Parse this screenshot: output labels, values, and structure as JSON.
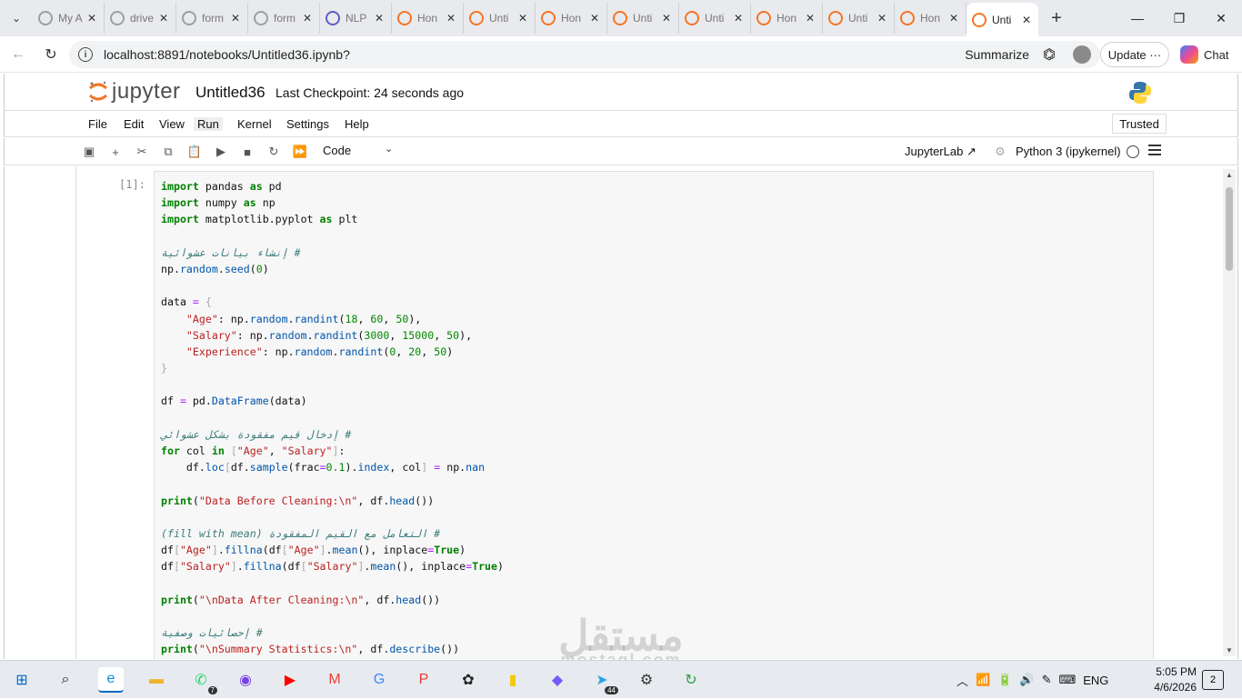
{
  "browser": {
    "tabs": [
      {
        "label": "My A",
        "icon": "globe-icon",
        "color": "#9aa0a6"
      },
      {
        "label": "drive",
        "icon": "drive-icon",
        "color": "#9aa0a6"
      },
      {
        "label": "form",
        "icon": "drive-icon",
        "color": "#9aa0a6"
      },
      {
        "label": "form",
        "icon": "drive-icon",
        "color": "#9aa0a6"
      },
      {
        "label": "NLP",
        "icon": "slides-icon",
        "color": "#5b5fc7"
      },
      {
        "label": "Hon",
        "icon": "jupyter-icon",
        "color": "#f37626"
      },
      {
        "label": "Unti",
        "icon": "notebook-icon",
        "color": "#f37626"
      },
      {
        "label": "Hon",
        "icon": "jupyter-icon",
        "color": "#f37626"
      },
      {
        "label": "Unti",
        "icon": "notebook-icon",
        "color": "#f37626"
      },
      {
        "label": "Unti",
        "icon": "jupyter-icon",
        "color": "#f37626"
      },
      {
        "label": "Hon",
        "icon": "jupyter-icon",
        "color": "#f37626"
      },
      {
        "label": "Unti",
        "icon": "notebook-icon",
        "color": "#f37626"
      },
      {
        "label": "Hon",
        "icon": "jupyter-icon",
        "color": "#f37626"
      },
      {
        "label": "Unti",
        "icon": "notebook-icon",
        "color": "#f37626",
        "active": true
      }
    ],
    "url": "localhost:8891/notebooks/Untitled36.ipynb?",
    "summarize_label": "Summarize",
    "update_label": "Update",
    "chat_label": "Chat"
  },
  "jupyter": {
    "logo_text": "jupyter",
    "notebook_title": "Untitled36",
    "checkpoint": "Last Checkpoint: 24 seconds ago",
    "menus": [
      "File",
      "Edit",
      "View",
      "Run",
      "Kernel",
      "Settings",
      "Help"
    ],
    "trusted_label": "Trusted",
    "cell_type": "Code",
    "jupyterlab_label": "JupyterLab",
    "kernel_label": "Python 3 (ipykernel)",
    "cell_prompt": "[1]:"
  },
  "code_lines": [
    [
      [
        "kw",
        "import"
      ],
      [
        "",
        " pandas "
      ],
      [
        "kw",
        "as"
      ],
      [
        "",
        " pd"
      ]
    ],
    [
      [
        "kw",
        "import"
      ],
      [
        "",
        " numpy "
      ],
      [
        "kw",
        "as"
      ],
      [
        "",
        " np"
      ]
    ],
    [
      [
        "kw",
        "import"
      ],
      [
        "",
        " matplotlib.pyplot "
      ],
      [
        "kw",
        "as"
      ],
      [
        "",
        " plt"
      ]
    ],
    [],
    [
      [
        "cm",
        "# إنشاء بيانات عشوائية"
      ]
    ],
    [
      [
        "",
        "np."
      ],
      [
        "fn",
        "random"
      ],
      [
        "",
        "."
      ],
      [
        "fn",
        "seed"
      ],
      [
        "",
        "("
      ],
      [
        "num",
        "0"
      ],
      [
        "",
        ")"
      ]
    ],
    [],
    [
      [
        "",
        "data "
      ],
      [
        "op",
        "="
      ],
      [
        "",
        " "
      ],
      [
        "br",
        "{"
      ]
    ],
    [
      [
        "",
        "    "
      ],
      [
        "str",
        "\"Age\""
      ],
      [
        "",
        ": np."
      ],
      [
        "fn",
        "random"
      ],
      [
        "",
        "."
      ],
      [
        "fn",
        "randint"
      ],
      [
        "",
        "("
      ],
      [
        "num",
        "18"
      ],
      [
        "",
        ", "
      ],
      [
        "num",
        "60"
      ],
      [
        "",
        ", "
      ],
      [
        "num",
        "50"
      ],
      [
        "",
        "),"
      ]
    ],
    [
      [
        "",
        "    "
      ],
      [
        "str",
        "\"Salary\""
      ],
      [
        "",
        ": np."
      ],
      [
        "fn",
        "random"
      ],
      [
        "",
        "."
      ],
      [
        "fn",
        "randint"
      ],
      [
        "",
        "("
      ],
      [
        "num",
        "3000"
      ],
      [
        "",
        ", "
      ],
      [
        "num",
        "15000"
      ],
      [
        "",
        ", "
      ],
      [
        "num",
        "50"
      ],
      [
        "",
        "),"
      ]
    ],
    [
      [
        "",
        "    "
      ],
      [
        "str",
        "\"Experience\""
      ],
      [
        "",
        ": np."
      ],
      [
        "fn",
        "random"
      ],
      [
        "",
        "."
      ],
      [
        "fn",
        "randint"
      ],
      [
        "",
        "("
      ],
      [
        "num",
        "0"
      ],
      [
        "",
        ", "
      ],
      [
        "num",
        "20"
      ],
      [
        "",
        ", "
      ],
      [
        "num",
        "50"
      ],
      [
        "",
        ")"
      ]
    ],
    [
      [
        "br",
        "}"
      ]
    ],
    [],
    [
      [
        "",
        "df "
      ],
      [
        "op",
        "="
      ],
      [
        "",
        " pd."
      ],
      [
        "fn",
        "DataFrame"
      ],
      [
        "",
        "(data)"
      ]
    ],
    [],
    [
      [
        "cm",
        "# إدخال قيم مفقودة بشكل عشوائي"
      ]
    ],
    [
      [
        "kw",
        "for"
      ],
      [
        "",
        " col "
      ],
      [
        "kw",
        "in"
      ],
      [
        "",
        " "
      ],
      [
        "br",
        "["
      ],
      [
        "str",
        "\"Age\""
      ],
      [
        "",
        ", "
      ],
      [
        "str",
        "\"Salary\""
      ],
      [
        "br",
        "]"
      ],
      [
        "",
        ":"
      ]
    ],
    [
      [
        "",
        "    df."
      ],
      [
        "fn",
        "loc"
      ],
      [
        "br",
        "["
      ],
      [
        "",
        "df."
      ],
      [
        "fn",
        "sample"
      ],
      [
        "",
        "(frac"
      ],
      [
        "op",
        "="
      ],
      [
        "num",
        "0.1"
      ],
      [
        "",
        ")."
      ],
      [
        "fn",
        "index"
      ],
      [
        "",
        ", col"
      ],
      [
        "br",
        "]"
      ],
      [
        "",
        " "
      ],
      [
        "op",
        "="
      ],
      [
        "",
        " np."
      ],
      [
        "fn",
        "nan"
      ]
    ],
    [],
    [
      [
        "kw",
        "print"
      ],
      [
        "",
        "("
      ],
      [
        "str",
        "\"Data Before Cleaning:\\n\""
      ],
      [
        "",
        ", df."
      ],
      [
        "fn",
        "head"
      ],
      [
        "",
        "())"
      ]
    ],
    [],
    [
      [
        "cm",
        "# التعامل مع القيم المفقودة (fill with mean)"
      ]
    ],
    [
      [
        "",
        "df"
      ],
      [
        "br",
        "["
      ],
      [
        "str",
        "\"Age\""
      ],
      [
        "br",
        "]"
      ],
      [
        "",
        "."
      ],
      [
        "fn",
        "fillna"
      ],
      [
        "",
        "(df"
      ],
      [
        "br",
        "["
      ],
      [
        "str",
        "\"Age\""
      ],
      [
        "br",
        "]"
      ],
      [
        "",
        "."
      ],
      [
        "fn",
        "mean"
      ],
      [
        "",
        "(), inplace"
      ],
      [
        "op",
        "="
      ],
      [
        "kw",
        "True"
      ],
      [
        "",
        ")"
      ]
    ],
    [
      [
        "",
        "df"
      ],
      [
        "br",
        "["
      ],
      [
        "str",
        "\"Salary\""
      ],
      [
        "br",
        "]"
      ],
      [
        "",
        "."
      ],
      [
        "fn",
        "fillna"
      ],
      [
        "",
        "(df"
      ],
      [
        "br",
        "["
      ],
      [
        "str",
        "\"Salary\""
      ],
      [
        "br",
        "]"
      ],
      [
        "",
        "."
      ],
      [
        "fn",
        "mean"
      ],
      [
        "",
        "(), inplace"
      ],
      [
        "op",
        "="
      ],
      [
        "kw",
        "True"
      ],
      [
        "",
        ")"
      ]
    ],
    [],
    [
      [
        "kw",
        "print"
      ],
      [
        "",
        "("
      ],
      [
        "str",
        "\"\\nData After Cleaning:\\n\""
      ],
      [
        "",
        ", df."
      ],
      [
        "fn",
        "head"
      ],
      [
        "",
        "())"
      ]
    ],
    [],
    [
      [
        "cm",
        "# إحصائيات وصفية"
      ]
    ],
    [
      [
        "kw",
        "print"
      ],
      [
        "",
        "("
      ],
      [
        "str",
        "\"\\nSummary Statistics:\\n\""
      ],
      [
        "",
        ", df."
      ],
      [
        "fn",
        "describe"
      ],
      [
        "",
        "())"
      ]
    ]
  ],
  "watermark": {
    "main": "مستقل",
    "sub": "mostaql.com"
  },
  "taskbar": {
    "apps": [
      {
        "icon": "windows-start-icon",
        "color": "#0067c0"
      },
      {
        "icon": "search-icon",
        "color": "#222222"
      },
      {
        "icon": "edge-icon",
        "color": "#0c8fd6"
      },
      {
        "icon": "file-explorer-icon",
        "color": "#f0b429"
      },
      {
        "icon": "whatsapp-icon",
        "color": "#25d366",
        "badge": "7"
      },
      {
        "icon": "firefox-icon",
        "color": "#7542e5"
      },
      {
        "icon": "youtube-icon",
        "color": "#ff0000"
      },
      {
        "icon": "gmail-icon",
        "color": "#ea4335"
      },
      {
        "icon": "google-icon",
        "color": "#4285f4"
      },
      {
        "icon": "pdf-icon",
        "color": "#e53935"
      },
      {
        "icon": "chatgpt-icon",
        "color": "#222222"
      },
      {
        "icon": "power-bi-icon",
        "color": "#f2c811"
      },
      {
        "icon": "copilot-app-icon",
        "color": "#7a5af8"
      },
      {
        "icon": "telegram-icon",
        "color": "#2aa3df",
        "badge": "44"
      },
      {
        "icon": "settings-icon",
        "color": "#333333"
      },
      {
        "icon": "refresh-app-icon",
        "color": "#2e9e47"
      }
    ],
    "tray_lang": "ENG",
    "time": "5:05 PM",
    "date": "4/6/2026",
    "notifications": "2"
  }
}
